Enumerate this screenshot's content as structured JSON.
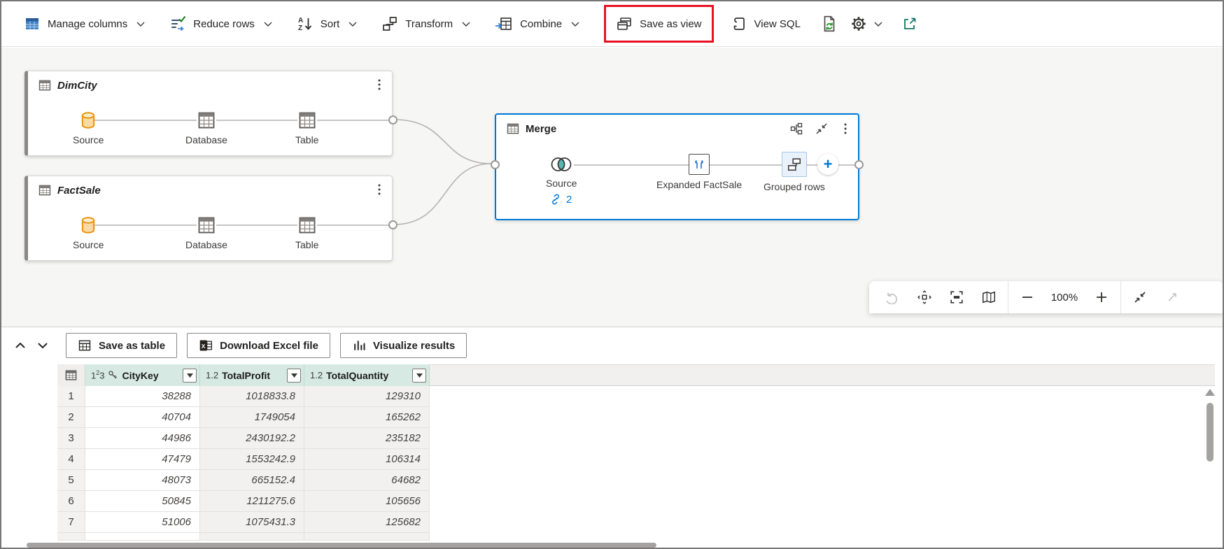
{
  "colors": {
    "accent": "#0078d4",
    "highlight_red": "#e81123",
    "header_mint": "#d6eae3",
    "teal": "#117865",
    "source_orange": "#e8940f"
  },
  "toolbar": {
    "items": [
      {
        "label": "Manage columns",
        "dropdown": true
      },
      {
        "label": "Reduce rows",
        "dropdown": true
      },
      {
        "label": "Sort",
        "dropdown": true
      },
      {
        "label": "Transform",
        "dropdown": true
      },
      {
        "label": "Combine",
        "dropdown": true
      },
      {
        "label": "Save as view",
        "dropdown": false,
        "highlighted": true
      },
      {
        "label": "View SQL",
        "dropdown": false
      }
    ],
    "icon_buttons": [
      "refresh-script",
      "settings",
      "open-in-new-window"
    ]
  },
  "diagram": {
    "nodes": [
      {
        "title": "DimCity",
        "steps": [
          "Source",
          "Database",
          "Table"
        ]
      },
      {
        "title": "FactSale",
        "steps": [
          "Source",
          "Database",
          "Table"
        ]
      },
      {
        "title": "Merge",
        "steps": [
          "Source",
          "Expanded FactSale",
          "Grouped rows"
        ],
        "selected": true,
        "link_count": "2"
      }
    ]
  },
  "canvas_toolbar": {
    "zoom_level": "100%"
  },
  "results": {
    "buttons": [
      "Save as table",
      "Download Excel file",
      "Visualize results"
    ],
    "grid": {
      "columns": [
        {
          "name": "CityKey",
          "type_label": "123",
          "is_key": true
        },
        {
          "name": "TotalProfit",
          "type_label": "1.2",
          "is_key": false
        },
        {
          "name": "TotalQuantity",
          "type_label": "1.2",
          "is_key": false
        }
      ],
      "rows": [
        [
          "1",
          "38288",
          "1018833.8",
          "129310"
        ],
        [
          "2",
          "40704",
          "1749054",
          "165262"
        ],
        [
          "3",
          "44986",
          "2430192.2",
          "235182"
        ],
        [
          "4",
          "47479",
          "1553242.9",
          "106314"
        ],
        [
          "5",
          "48073",
          "665152.4",
          "64682"
        ],
        [
          "6",
          "50845",
          "1211275.6",
          "105656"
        ],
        [
          "7",
          "51006",
          "1075431.3",
          "125682"
        ]
      ]
    }
  }
}
